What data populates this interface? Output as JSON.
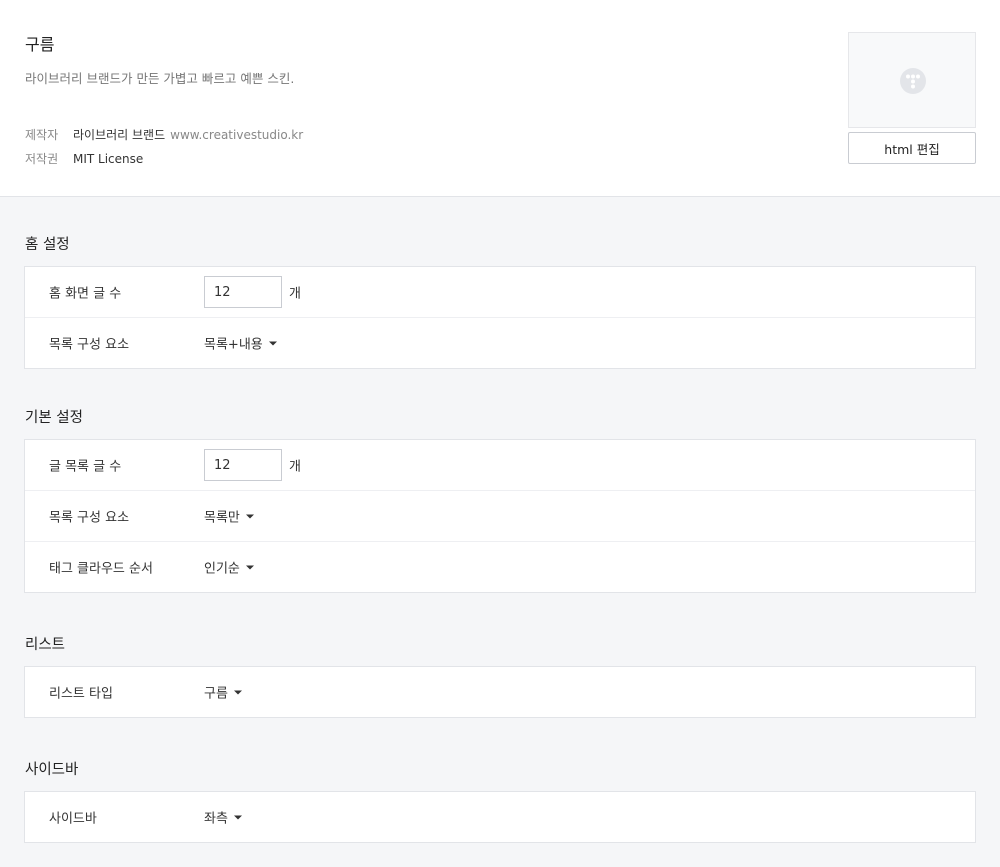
{
  "skin": {
    "title": "구름",
    "description": "라이브러리 브랜드가 만든 가볍고 빠르고 예쁜 스킨.",
    "maker_label": "제작자",
    "maker_name": "라이브러리 브랜드",
    "maker_link": "www.creativestudio.kr",
    "copyright_label": "저작권",
    "copyright_value": "MIT License",
    "edit_button": "html 편집"
  },
  "sections": {
    "home": {
      "title": "홈 설정",
      "post_count_label": "홈 화면 글 수",
      "post_count_value": "12",
      "post_count_unit": "개",
      "list_elements_label": "목록 구성 요소",
      "list_elements_value": "목록+내용"
    },
    "basic": {
      "title": "기본 설정",
      "list_count_label": "글 목록 글 수",
      "list_count_value": "12",
      "list_count_unit": "개",
      "list_elements_label": "목록 구성 요소",
      "list_elements_value": "목록만",
      "tag_order_label": "태그 클라우드 순서",
      "tag_order_value": "인기순"
    },
    "list": {
      "title": "리스트",
      "type_label": "리스트 타입",
      "type_value": "구름"
    },
    "sidebar": {
      "title": "사이드바",
      "position_label": "사이드바",
      "position_value": "좌측"
    }
  }
}
